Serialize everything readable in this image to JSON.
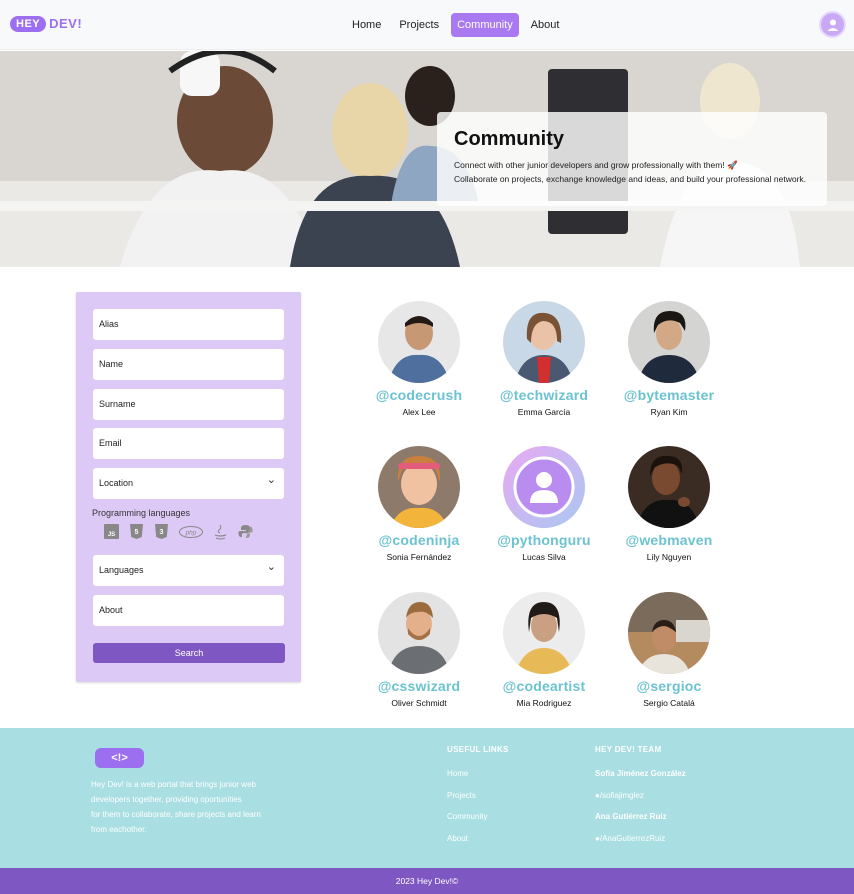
{
  "brand": {
    "logo_left": "HEY",
    "logo_right": "DEV!",
    "accent": "#9c6ef0",
    "teal": "#6cc3d0",
    "footer_bg": "#a9dee2",
    "bottom_bg": "#7e57c2"
  },
  "nav": {
    "items": [
      {
        "label": "Home"
      },
      {
        "label": "Projects"
      },
      {
        "label": "Community"
      },
      {
        "label": "About"
      }
    ],
    "active": "Community"
  },
  "hero": {
    "title": "Community",
    "line1": "Connect with other junior developers and grow professionally with them! 🚀",
    "line2": "Collaborate on projects, exchange knowledge and ideas, and build your professional network."
  },
  "filter": {
    "alias": "Alias",
    "name": "Name",
    "surname": "Surname",
    "email": "Email",
    "location": "Location",
    "programming_label": "Programming languages",
    "icons": [
      "js-icon",
      "html5-icon",
      "css3-icon",
      "php-icon",
      "java-icon",
      "python-icon"
    ],
    "languages": "Languages",
    "about": "About",
    "search": "Search"
  },
  "profiles": [
    {
      "handle": "@codecrush",
      "name": "Alex Lee"
    },
    {
      "handle": "@techwizard",
      "name": "Emma García"
    },
    {
      "handle": "@bytemaster",
      "name": "Ryan Kim"
    },
    {
      "handle": "@codeninja",
      "name": "Sonia Fernández"
    },
    {
      "handle": "@pythonguru",
      "name": "Lucas Silva"
    },
    {
      "handle": "@webmaven",
      "name": "Lily Nguyen"
    },
    {
      "handle": "@csswizard",
      "name": "Oliver Schmidt"
    },
    {
      "handle": "@codeartist",
      "name": "Mia Rodriguez"
    },
    {
      "handle": "@sergioc",
      "name": "Sergio Catalá"
    }
  ],
  "footer": {
    "logo": "<!>",
    "about_lines": [
      "Hey Dev! is a web portal that brings junior web",
      "developers together, providing oportunities",
      "for them to collaborate, share projects and learn",
      "from eachother."
    ],
    "links_title": "USEFUL LINKS",
    "links": [
      "Home",
      "Projects",
      "Community",
      "About"
    ],
    "team_title": "HEY DEV! TEAM",
    "team": [
      {
        "name": "Sofía Jiménez González",
        "github": "/sofiajimglez"
      },
      {
        "name": "Ana Gutiérrez Ruiz",
        "github": "/AnaGutierrezRuiz"
      }
    ],
    "copyright": "2023 Hey Dev!©"
  }
}
